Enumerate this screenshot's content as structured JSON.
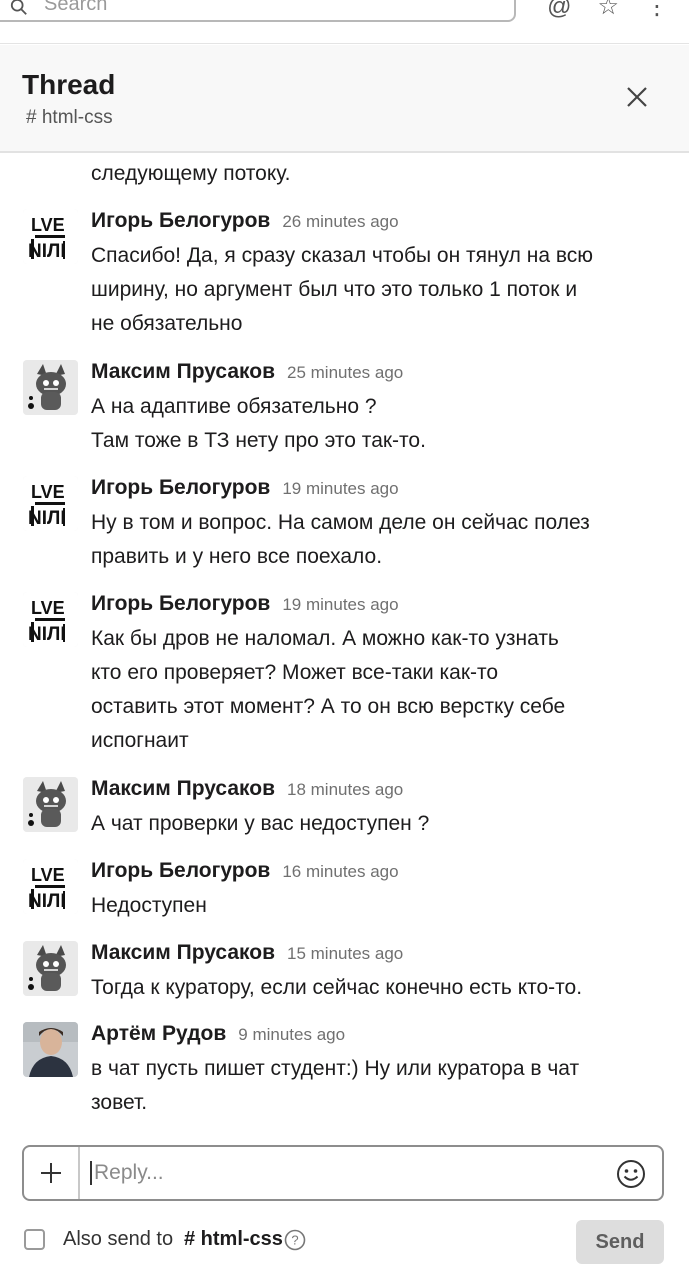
{
  "search": {
    "placeholder": "Search"
  },
  "top_icons": [
    "mention-icon",
    "star-icon",
    "more-vertical-icon"
  ],
  "thread": {
    "title": "Thread",
    "channel": "# html-css"
  },
  "messages": [
    {
      "author": "",
      "time": "",
      "text": "следующему потоку."
    },
    {
      "author": "Игорь Белогуров",
      "time": "26 minutes ago",
      "avatar": "love-poster",
      "text": "Спасибо! Да, я сразу сказал чтобы он тянул на всю\nширину, но аргумент был что это только 1 поток и\nне обязательно"
    },
    {
      "author": "Максим Прусаков",
      "time": "25 minutes ago",
      "avatar": "cat",
      "text": "А на адаптиве обязательно ?\nТам тоже в ТЗ нету про это так-то."
    },
    {
      "author": "Игорь Белогуров",
      "time": "19 minutes ago",
      "avatar": "love-poster",
      "text": "Ну в том и вопрос. На самом деле он сейчас полез\nправить и у него все поехало."
    },
    {
      "author": "Игорь Белогуров",
      "time": "19 minutes ago",
      "avatar": "love-poster",
      "text": "Как бы дров не наломал. А можно как-то узнать\nкто его проверяет? Может все-таки как-то\nоставить этот момент? А то он всю верстку себе\nиспогнаит"
    },
    {
      "author": "Максим Прусаков",
      "time": "18 minutes ago",
      "avatar": "cat",
      "text": "А чат проверки у вас недоступен ?"
    },
    {
      "author": "Игорь Белогуров",
      "time": "16 minutes ago",
      "avatar": "love-poster",
      "text": "Недоступен"
    },
    {
      "author": "Максим Прусаков",
      "time": "15 minutes ago",
      "avatar": "cat",
      "text": "Тогда к куратору, если сейчас конечно есть кто-то."
    },
    {
      "author": "Артём Рудов",
      "time": "9 minutes ago",
      "avatar": "photo",
      "text": "в чат пусть пишет студент:) Ну или куратора в чат\nзовет."
    }
  ],
  "composer": {
    "placeholder": "Reply..."
  },
  "footer": {
    "also_send_label": "Also send to",
    "channel": "# html-css",
    "send_label": "Send"
  }
}
